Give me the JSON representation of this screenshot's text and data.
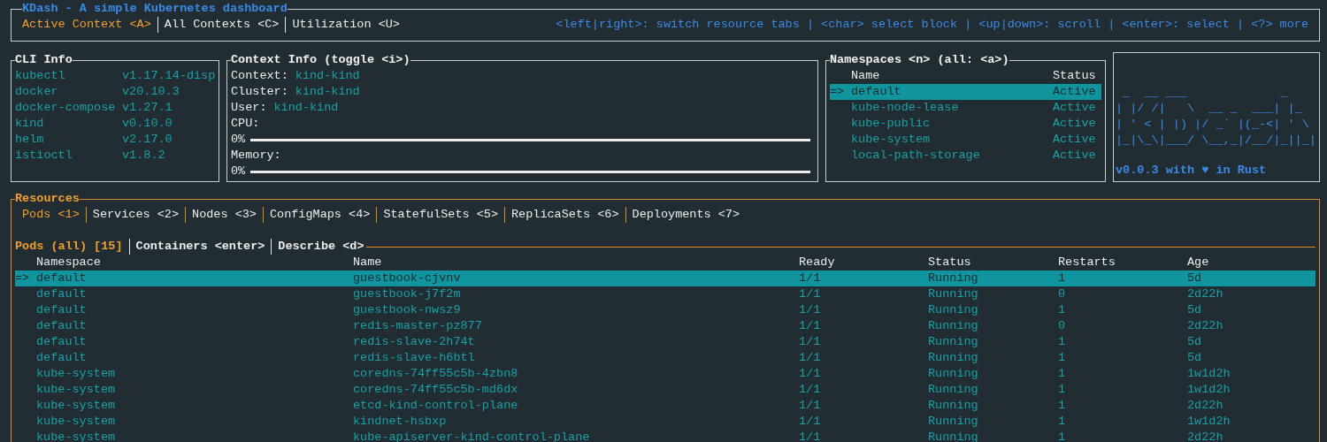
{
  "header": {
    "title": "KDash - A simple Kubernetes dashboard",
    "tabs": [
      {
        "label": "Active Context <A>",
        "selected": true
      },
      {
        "label": "All Contexts <C>",
        "selected": false
      },
      {
        "label": "Utilization <U>",
        "selected": false
      }
    ],
    "help": "<left|right>: switch resource tabs | <char> select block | <up|down>: scroll | <enter>: select | <?> more"
  },
  "cli_info": {
    "title": "CLI Info",
    "items": [
      {
        "name": "kubectl",
        "version": "v1.17.14-disp"
      },
      {
        "name": "docker",
        "version": "v20.10.3"
      },
      {
        "name": "docker-compose",
        "version": "v1.27.1"
      },
      {
        "name": "kind",
        "version": "v0.10.0"
      },
      {
        "name": "helm",
        "version": "v2.17.0"
      },
      {
        "name": "istioctl",
        "version": "v1.8.2"
      }
    ]
  },
  "context_info": {
    "title": "Context Info (toggle <i>)",
    "fields": [
      {
        "label": "Context:",
        "value": "kind-kind"
      },
      {
        "label": "Cluster:",
        "value": "kind-kind"
      },
      {
        "label": "User:",
        "value": "kind-kind"
      }
    ],
    "gauges": [
      {
        "label": "CPU:",
        "reading": "0%",
        "level": 0
      },
      {
        "label": "Memory:",
        "reading": "0%",
        "level": 0
      }
    ]
  },
  "namespaces": {
    "title": "Namespaces <n> (all: <a>)",
    "highlight_symbol": "=>",
    "columns": [
      "Name",
      "Status"
    ],
    "rows": [
      {
        "name": "default",
        "status": "Active",
        "selected": true
      },
      {
        "name": "kube-node-lease",
        "status": "Active",
        "selected": false
      },
      {
        "name": "kube-public",
        "status": "Active",
        "selected": false
      },
      {
        "name": "kube-system",
        "status": "Active",
        "selected": false
      },
      {
        "name": "local-path-storage",
        "status": "Active",
        "selected": false
      }
    ]
  },
  "logo": {
    "art": [
      " _  __ ___             _",
      "| |/ /|   \\  __ _  ___| |_",
      "| ' < | |) |/ _` |(_-<| ' \\",
      "|_|\\_\\|___/ \\__,_|/__/|_||_|"
    ],
    "tagline": "v0.0.3 with ♥ in Rust"
  },
  "resources": {
    "title": "Resources",
    "tabs": [
      {
        "label": "Pods <1>",
        "selected": true
      },
      {
        "label": "Services <2>",
        "selected": false
      },
      {
        "label": "Nodes <3>",
        "selected": false
      },
      {
        "label": "ConfigMaps <4>",
        "selected": false
      },
      {
        "label": "StatefulSets <5>",
        "selected": false
      },
      {
        "label": "ReplicaSets <6>",
        "selected": false
      },
      {
        "label": "Deployments <7>",
        "selected": false
      }
    ],
    "views": [
      {
        "label": "Pods (all) [15]",
        "selected": true
      },
      {
        "label": "Containers <enter>",
        "selected": false
      },
      {
        "label": "Describe <d>",
        "selected": false
      }
    ],
    "table": {
      "highlight_symbol": "=>",
      "columns": [
        "Namespace",
        "Name",
        "Ready",
        "Status",
        "Restarts",
        "Age"
      ],
      "rows": [
        {
          "cells": [
            "default",
            "guestbook-cjvnv",
            "1/1",
            "Running",
            "1",
            "5d"
          ],
          "selected": true
        },
        {
          "cells": [
            "default",
            "guestbook-j7f2m",
            "1/1",
            "Running",
            "0",
            "2d22h"
          ],
          "selected": false
        },
        {
          "cells": [
            "default",
            "guestbook-nwsz9",
            "1/1",
            "Running",
            "1",
            "5d"
          ],
          "selected": false
        },
        {
          "cells": [
            "default",
            "redis-master-pz877",
            "1/1",
            "Running",
            "0",
            "2d22h"
          ],
          "selected": false
        },
        {
          "cells": [
            "default",
            "redis-slave-2h74t",
            "1/1",
            "Running",
            "1",
            "5d"
          ],
          "selected": false
        },
        {
          "cells": [
            "default",
            "redis-slave-h6btl",
            "1/1",
            "Running",
            "1",
            "5d"
          ],
          "selected": false
        },
        {
          "cells": [
            "kube-system",
            "coredns-74ff55c5b-4zbn8",
            "1/1",
            "Running",
            "1",
            "1w1d2h"
          ],
          "selected": false
        },
        {
          "cells": [
            "kube-system",
            "coredns-74ff55c5b-md6dx",
            "1/1",
            "Running",
            "1",
            "1w1d2h"
          ],
          "selected": false
        },
        {
          "cells": [
            "kube-system",
            "etcd-kind-control-plane",
            "1/1",
            "Running",
            "1",
            "2d22h"
          ],
          "selected": false
        },
        {
          "cells": [
            "kube-system",
            "kindnet-hsbxp",
            "1/1",
            "Running",
            "1",
            "1w1d2h"
          ],
          "selected": false
        },
        {
          "cells": [
            "kube-system",
            "kube-apiserver-kind-control-plane",
            "1/1",
            "Running",
            "1",
            "2d22h"
          ],
          "selected": false
        }
      ]
    }
  }
}
